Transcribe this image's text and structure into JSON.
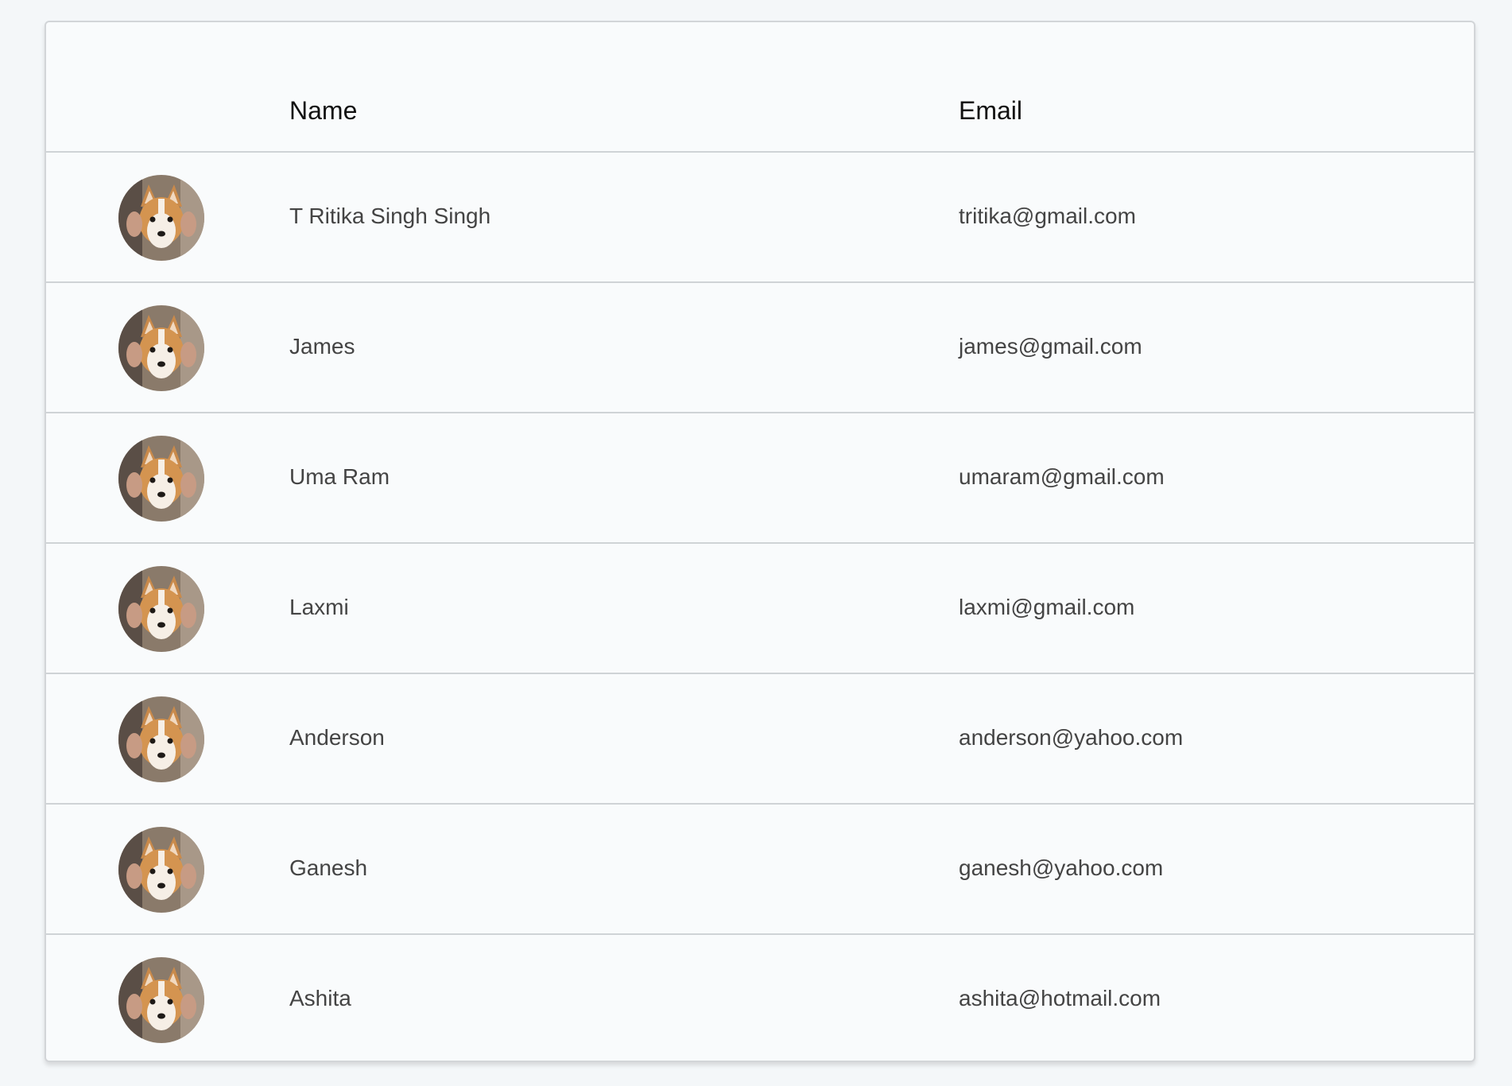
{
  "table": {
    "headers": {
      "avatar": "",
      "name": "Name",
      "email": "Email"
    },
    "rows": [
      {
        "name": "T Ritika Singh Singh",
        "email": "tritika@gmail.com",
        "avatar_icon": "corgi-photo-avatar"
      },
      {
        "name": "James",
        "email": "james@gmail.com",
        "avatar_icon": "corgi-photo-avatar"
      },
      {
        "name": "Uma Ram",
        "email": "umaram@gmail.com",
        "avatar_icon": "corgi-photo-avatar"
      },
      {
        "name": "Laxmi",
        "email": "laxmi@gmail.com",
        "avatar_icon": "corgi-photo-avatar"
      },
      {
        "name": "Anderson",
        "email": "anderson@yahoo.com",
        "avatar_icon": "corgi-photo-avatar"
      },
      {
        "name": "Ganesh",
        "email": "ganesh@yahoo.com",
        "avatar_icon": "corgi-photo-avatar"
      },
      {
        "name": "Ashita",
        "email": "ashita@hotmail.com",
        "avatar_icon": "corgi-photo-avatar"
      }
    ]
  },
  "colors": {
    "background": "#f4f7f9",
    "card": "#f9fbfc",
    "divider": "#cfd3d6",
    "header_text": "#111111",
    "cell_text": "#444444"
  }
}
